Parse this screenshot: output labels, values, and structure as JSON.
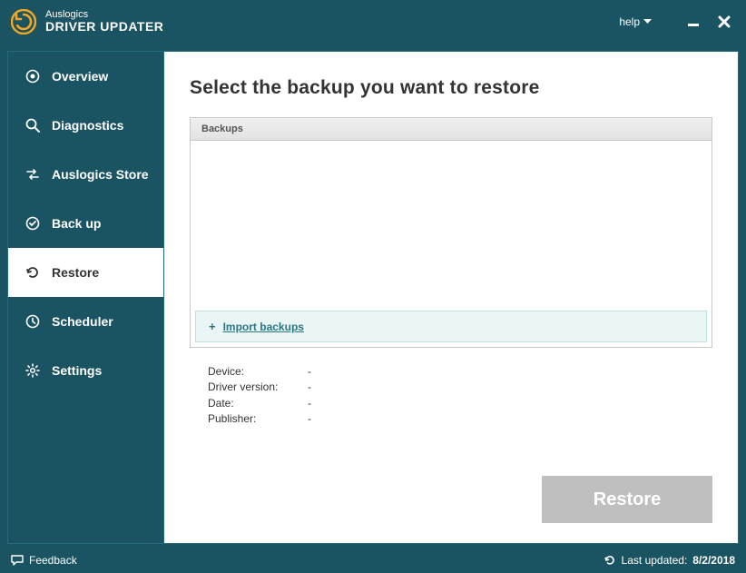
{
  "titlebar": {
    "line1": "Auslogics",
    "line2": "DRIVER UPDATER",
    "help": "help"
  },
  "sidebar": {
    "items": [
      {
        "label": "Overview"
      },
      {
        "label": "Diagnostics"
      },
      {
        "label": "Auslogics Store"
      },
      {
        "label": "Back up"
      },
      {
        "label": "Restore"
      },
      {
        "label": "Scheduler"
      },
      {
        "label": "Settings"
      }
    ]
  },
  "main": {
    "title": "Select the backup you want to restore",
    "panel_header": "Backups",
    "import_plus": "+",
    "import_label": "Import backups",
    "details": {
      "device_label": "Device:",
      "device_value": "-",
      "driver_version_label": "Driver version:",
      "driver_version_value": "-",
      "date_label": "Date:",
      "date_value": "-",
      "publisher_label": "Publisher:",
      "publisher_value": "-"
    },
    "restore_button": "Restore"
  },
  "statusbar": {
    "feedback": "Feedback",
    "last_updated_label": "Last updated:",
    "last_updated_value": "8/2/2018"
  }
}
